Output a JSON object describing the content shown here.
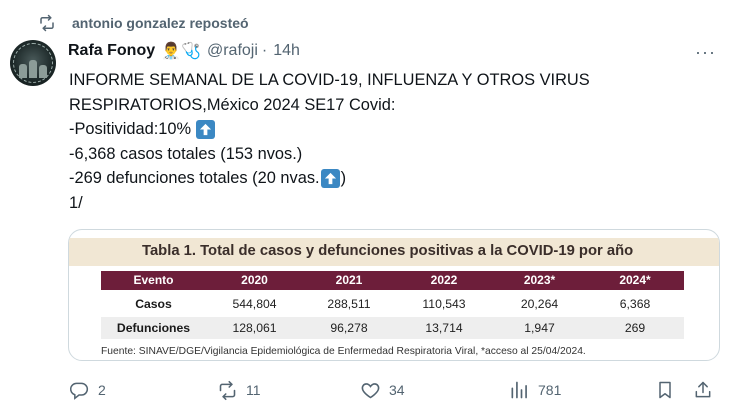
{
  "repost": {
    "text": "antonio gonzalez reposteó",
    "icon": "repost-icon"
  },
  "author": {
    "name": "Rafa Fonoy",
    "emojis": "👨‍⚕️🩺",
    "handle": "@rafoji",
    "separator": "·",
    "time": "14h"
  },
  "more_label": "···",
  "tweet": {
    "lines": [
      "INFORME SEMANAL DE LA COVID-19, INFLUENZA Y OTROS VIRUS",
      "RESPIRATORIOS,México 2024 SE17  Covid:",
      "-Positividad:10%",
      "-6,368 casos totales (153 nvos.)",
      "-269 defunciones totales (20 nvas.",
      "1/"
    ],
    "line5_tail": ")"
  },
  "table": {
    "title": "Tabla 1. Total de casos y defunciones positivas a la COVID-19 por año",
    "headers": [
      "Evento",
      "2020",
      "2021",
      "2022",
      "2023*",
      "2024*"
    ],
    "rows": [
      [
        "Casos",
        "544,804",
        "288,511",
        "110,543",
        "20,264",
        "6,368"
      ],
      [
        "Defunciones",
        "128,061",
        "96,278",
        "13,714",
        "1,947",
        "269"
      ]
    ],
    "source": "Fuente: SINAVE/DGE/Vigilancia Epidemiológica de Enfermedad Respiratoria Viral, *acceso al 25/04/2024.",
    "colors": {
      "header_bg": "#6d1e3a",
      "title_bg": "#f1e7d4"
    }
  },
  "actions": {
    "replies": "2",
    "reposts": "11",
    "likes": "34",
    "views": "781"
  },
  "colors": {
    "muted": "#536471",
    "text": "#0f1419",
    "emoji_blue": "#3b88c3"
  }
}
